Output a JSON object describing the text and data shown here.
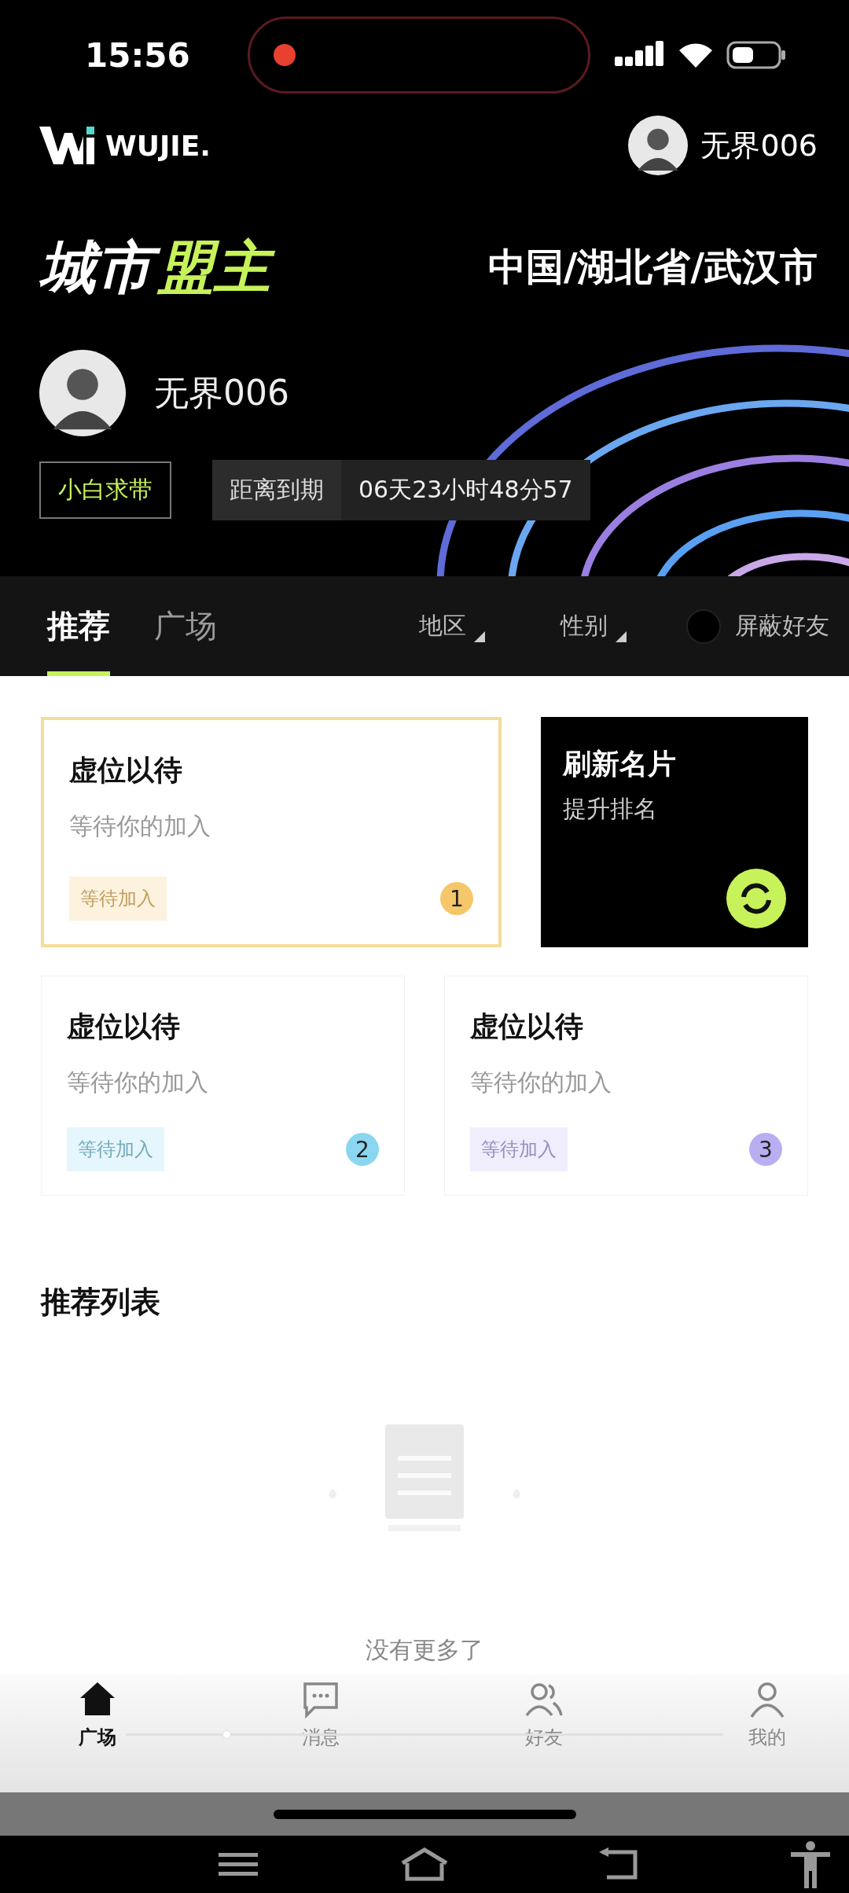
{
  "status_bar": {
    "time": "15:56",
    "recording": true
  },
  "header": {
    "brand": "WUJIE.",
    "user_name": "无界006",
    "title_parts": [
      {
        "text": "城市",
        "accent": false
      },
      {
        "text": "盟主",
        "accent": true
      }
    ],
    "location": "中国/湖北省/武汉市",
    "profile_name": "无界006",
    "tag": "小白求带",
    "expiry_label": "距离到期",
    "expiry_value": "06天23小时48分57"
  },
  "tabs": [
    {
      "label": "推荐",
      "selected": true
    },
    {
      "label": "广场",
      "selected": false
    }
  ],
  "filters": [
    {
      "label": "地区"
    },
    {
      "label": "性别"
    }
  ],
  "hide_friends": {
    "label": "屏蔽好友",
    "on": false
  },
  "slots": [
    {
      "title": "虚位以待",
      "subtitle": "等待你的加入",
      "tag": "等待加入",
      "rank": "1",
      "color": "#f5c66a",
      "highlighted": true
    },
    {
      "title": "虚位以待",
      "subtitle": "等待你的加入",
      "tag": "等待加入",
      "rank": "2",
      "color": "#8ad6f0",
      "highlighted": false
    },
    {
      "title": "虚位以待",
      "subtitle": "等待你的加入",
      "tag": "等待加入",
      "rank": "3",
      "color": "#b9aef2",
      "highlighted": false
    }
  ],
  "refresh_card": {
    "title": "刷新名片",
    "subtitle": "提升排名"
  },
  "list": {
    "title": "推荐列表",
    "empty_text": "没有更多了"
  },
  "bottom_nav": [
    {
      "label": "广场",
      "selected": true
    },
    {
      "label": "消息",
      "selected": false
    },
    {
      "label": "好友",
      "selected": false
    },
    {
      "label": "我的",
      "selected": false
    }
  ],
  "playback_bar": {
    "level": 0.17
  }
}
